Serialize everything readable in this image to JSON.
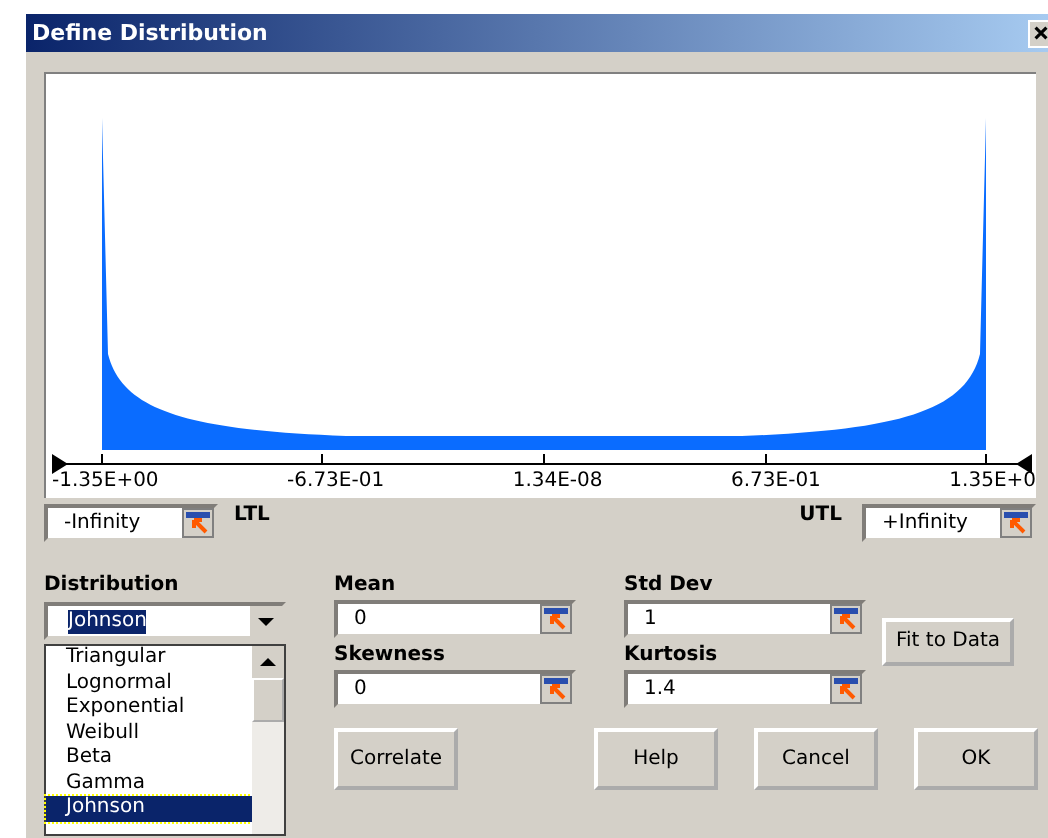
{
  "window": {
    "title": "Define Distribution"
  },
  "chart": {
    "axis_labels": [
      "-1.35E+00",
      "-6.73E-01",
      "1.34E-08",
      "6.73E-01",
      "1.35E+0"
    ]
  },
  "limits": {
    "lower": {
      "label": "LTL",
      "value": "-Infinity"
    },
    "upper": {
      "label": "UTL",
      "value": "+Infinity"
    }
  },
  "distribution": {
    "label": "Distribution",
    "value": "Johnson",
    "options": [
      {
        "label": "Triangular",
        "selected": false
      },
      {
        "label": "Lognormal",
        "selected": false
      },
      {
        "label": "Exponential",
        "selected": false
      },
      {
        "label": "Weibull",
        "selected": false
      },
      {
        "label": "Beta",
        "selected": false
      },
      {
        "label": "Gamma",
        "selected": false
      },
      {
        "label": "Johnson",
        "selected": true
      }
    ]
  },
  "parameters": [
    {
      "label": "Mean",
      "value": "0"
    },
    {
      "label": "Std Dev",
      "value": "1"
    },
    {
      "label": "Skewness",
      "value": "0"
    },
    {
      "label": "Kurtosis",
      "value": "1.4"
    }
  ],
  "buttons": {
    "fit": "Fit to Data",
    "actions": [
      "Correlate",
      "Help",
      "Cancel",
      "OK"
    ]
  }
}
